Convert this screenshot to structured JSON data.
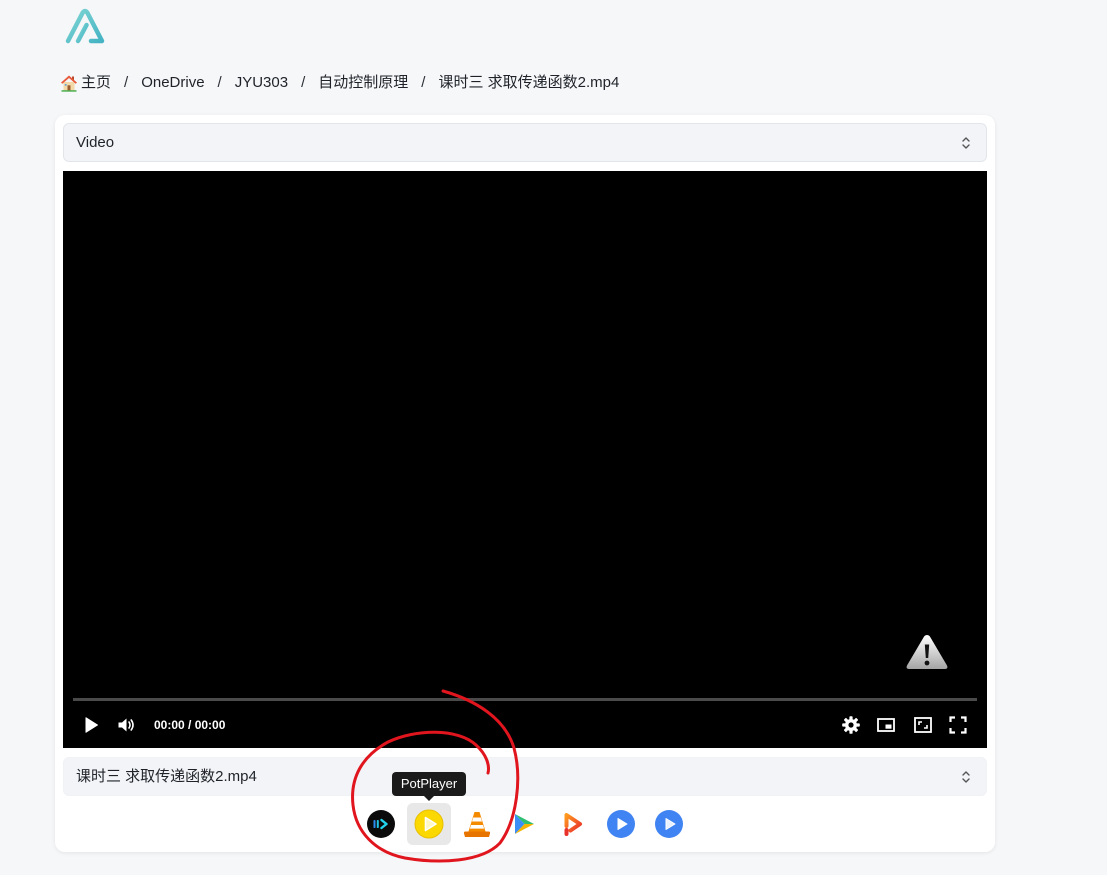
{
  "logo": {
    "icon": "app-logo-icon"
  },
  "breadcrumb": {
    "home_icon": "home-icon",
    "items": [
      "主页",
      "OneDrive",
      "JYU303",
      "自动控制原理",
      "课时三 求取传递函数2.mp4"
    ],
    "separator": "/"
  },
  "preview_type_select": {
    "value": "Video",
    "icon": "chevron-up-down-icon"
  },
  "video_player": {
    "time": "00:00 / 00:00",
    "progress": 0,
    "status_icon": "warning-icon",
    "controls": {
      "left": [
        "play-icon",
        "volume-icon"
      ],
      "right": [
        "settings-icon",
        "picture-in-picture-icon",
        "web-fullscreen-icon",
        "fullscreen-icon"
      ]
    }
  },
  "file_select": {
    "value": "课时三 求取传递函数2.mp4",
    "icon": "chevron-up-down-icon"
  },
  "external_players": {
    "tooltip": "PotPlayer",
    "hovered": "potplayer-icon",
    "icons": [
      "iina-icon",
      "potplayer-icon",
      "vlc-icon",
      "nplayer-icon",
      "infuse-icon",
      "mxplayer-icon",
      "mxplayer-pro-icon"
    ]
  },
  "colors": {
    "page_background": "#f6f7f9",
    "card_background": "#ffffff",
    "select_background": "#f2f4f7",
    "select_border": "#e2e6eb",
    "video_background": "#000000",
    "tooltip_background": "#1b1b1b",
    "logo_teal": "#5ec6c8",
    "annotation_red": "#e0151d"
  }
}
